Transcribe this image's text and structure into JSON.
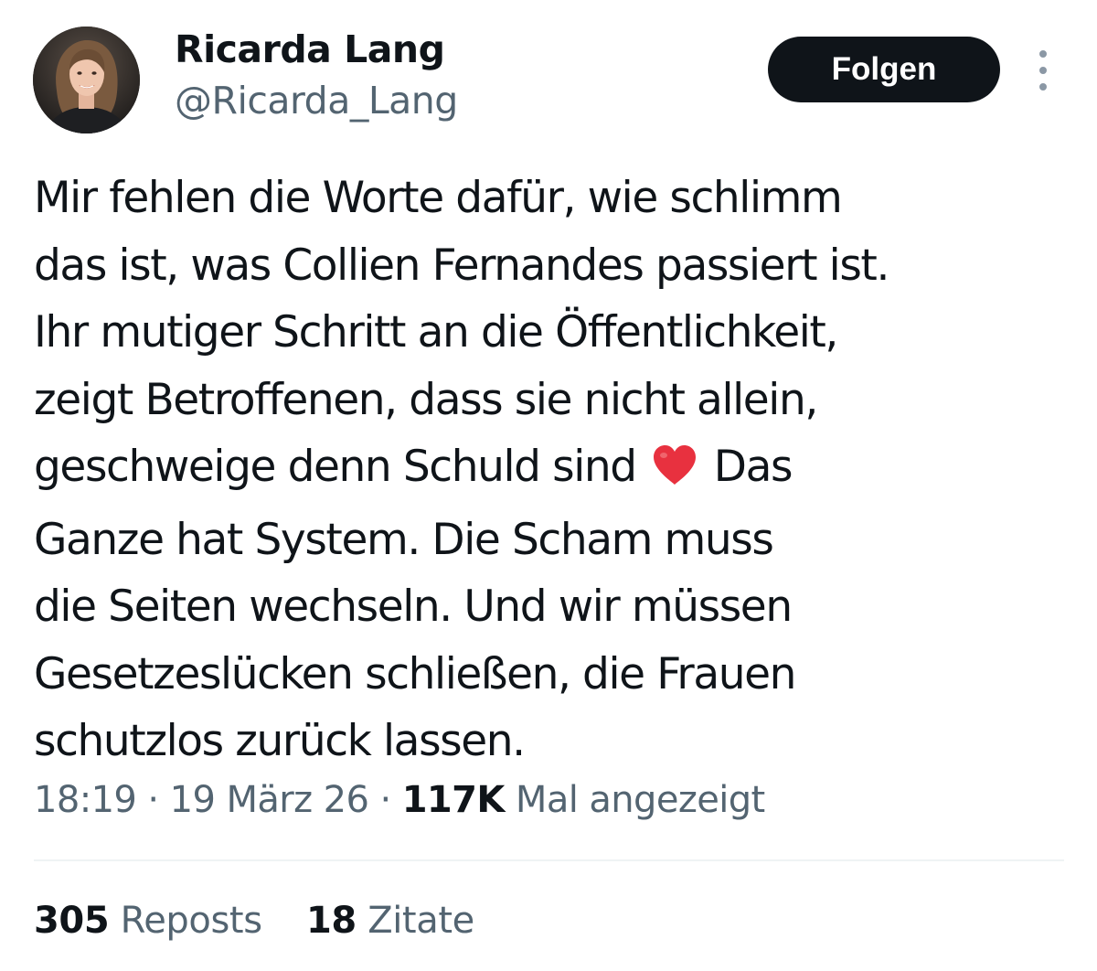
{
  "author": {
    "display_name": "Ricarda Lang",
    "handle": "@Ricarda_Lang",
    "avatar_icon": "profile-photo"
  },
  "follow_button_label": "Folgen",
  "more_icon": "more-vertical-icon",
  "tweet": {
    "lines": [
      "Mir fehlen die Worte dafür, wie schlimm",
      "das ist, was Collien Fernandes passiert ist.",
      "Ihr mutiger Schritt an die Öffentlichkeit,",
      "zeigt Betroffenen, dass sie nicht allein,"
    ],
    "line5_before": "geschweige denn Schuld sind",
    "line5_emoji": "❤️",
    "line5_after": "Das",
    "lines_rest": [
      "Ganze hat System. Die Scham muss",
      "die Seiten wechseln. Und wir müssen",
      "Gesetzeslücken schließen, die Frauen",
      "schutzlos zurück lassen."
    ]
  },
  "meta": {
    "time": "18:19",
    "separator": "·",
    "date": "19 März 26",
    "views_count": "117K",
    "views_label": "Mal angezeigt"
  },
  "stats": {
    "reposts_count": "305",
    "reposts_label": "Reposts",
    "quotes_count": "18",
    "quotes_label": "Zitate"
  },
  "colors": {
    "text_primary": "#0f1419",
    "text_secondary": "#536471",
    "heart": "#e8313f"
  }
}
